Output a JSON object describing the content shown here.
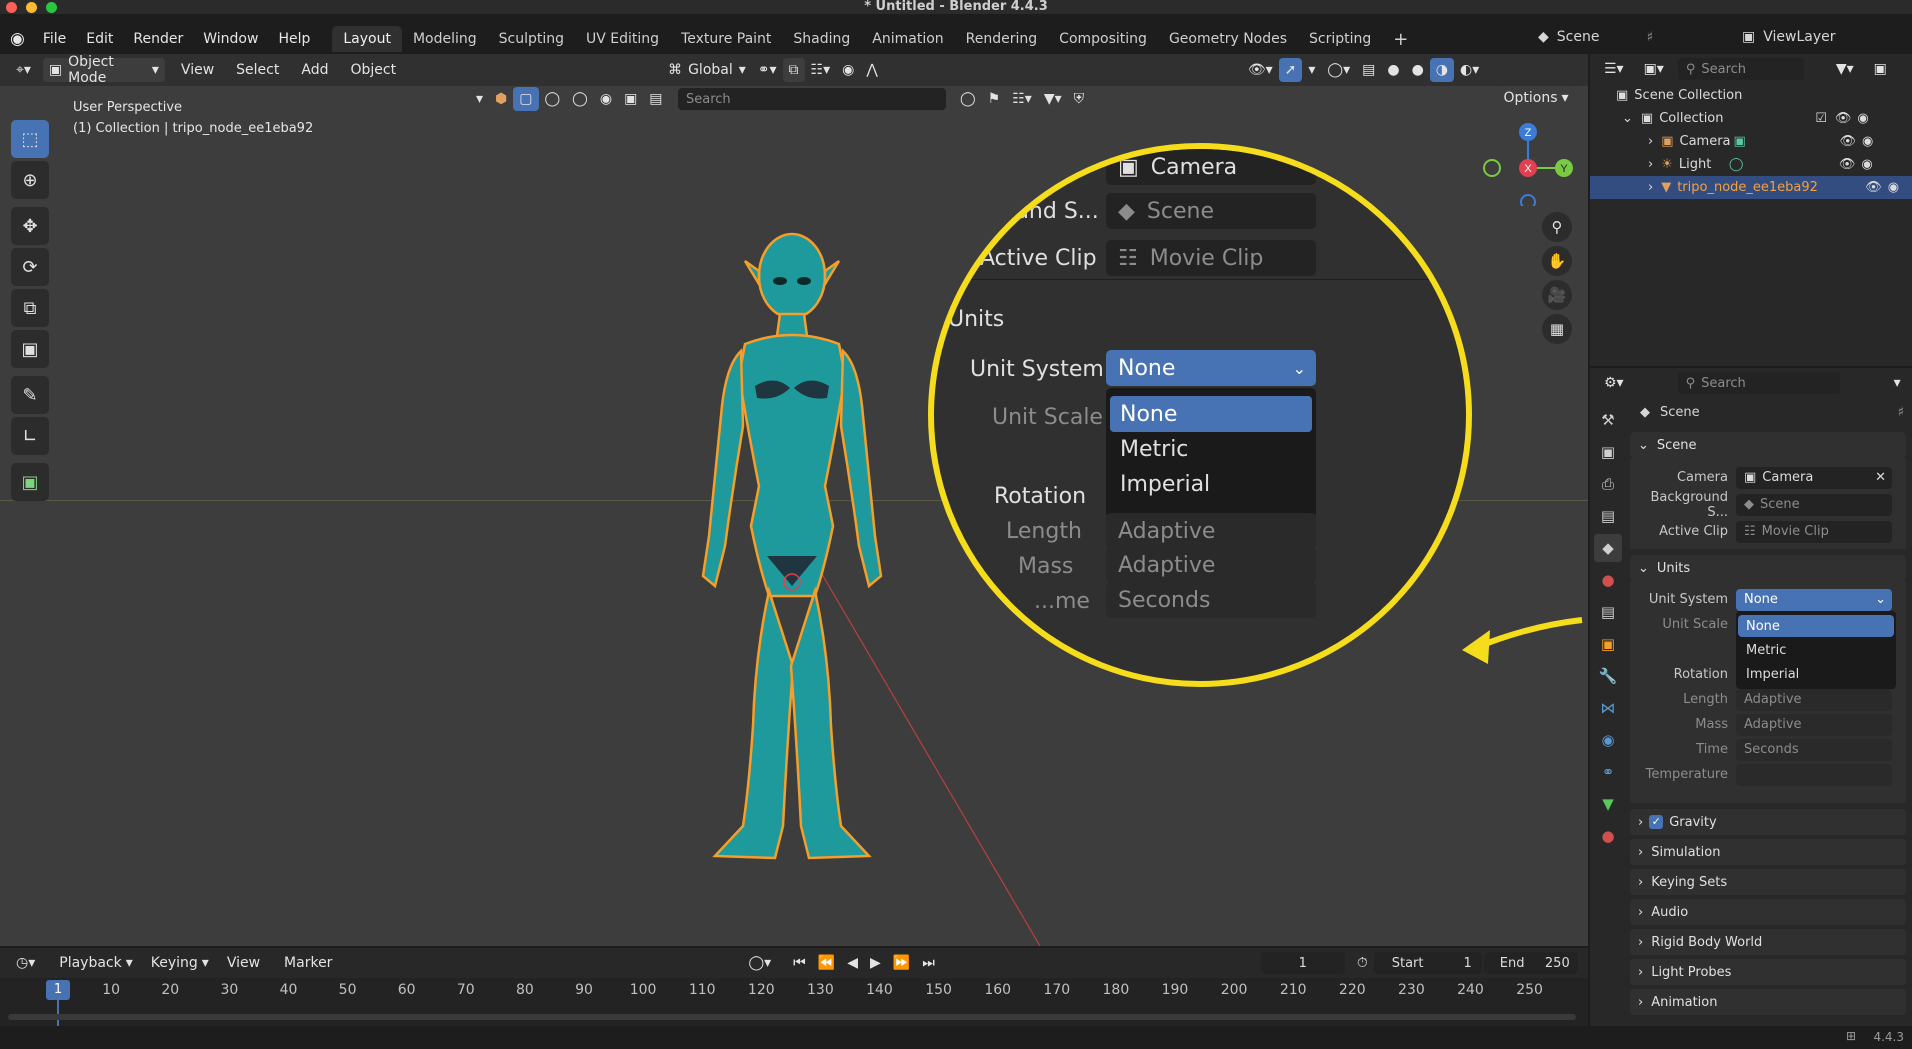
{
  "window": {
    "title": "* Untitled - Blender 4.4.3"
  },
  "menu": {
    "items": [
      "File",
      "Edit",
      "Render",
      "Window",
      "Help"
    ]
  },
  "workspaces": [
    "Layout",
    "Modeling",
    "Sculpting",
    "UV Editing",
    "Texture Paint",
    "Shading",
    "Animation",
    "Rendering",
    "Compositing",
    "Geometry Nodes",
    "Scripting"
  ],
  "top_right": {
    "scene": "Scene",
    "view_layer": "ViewLayer"
  },
  "view_header": {
    "mode": "Object Mode",
    "menus": [
      "View",
      "Select",
      "Add",
      "Object"
    ],
    "transform": "Global",
    "options": "Options",
    "search_placeholder": "Search"
  },
  "viewport": {
    "perspective": "User Perspective",
    "collection_info": "(1) Collection | tripo_node_ee1eba92",
    "gizmo": {
      "z": "Z",
      "x": "X",
      "y": "Y"
    }
  },
  "zoom": {
    "camera_value": "Camera",
    "background_label": "...und S...",
    "background_value": "Scene",
    "clip_label": "Active Clip",
    "clip_value": "Movie Clip",
    "units_header": "Units",
    "unit_system_label": "Unit System",
    "unit_system_value": "None",
    "unit_scale_label": "Unit Scale",
    "rotation_label": "Rotation",
    "length_label": "Length",
    "length_value": "Adaptive",
    "mass_label": "Mass",
    "mass_value": "Adaptive",
    "time_label": "...me",
    "time_value": "Seconds",
    "options": [
      "None",
      "Metric",
      "Imperial"
    ]
  },
  "outliner": {
    "search_placeholder": "Search",
    "root": "Scene Collection",
    "collection": "Collection",
    "items": [
      "Camera",
      "Light",
      "tripo_node_ee1eba92"
    ]
  },
  "properties": {
    "search_placeholder": "Search",
    "context": "Scene",
    "scene_header": "Scene",
    "camera_label": "Camera",
    "camera_value": "Camera",
    "bg_label": "Background S...",
    "bg_value": "Scene",
    "clip_label": "Active Clip",
    "clip_value": "Movie Clip",
    "units_header": "Units",
    "unit_system_label": "Unit System",
    "unit_system_value": "None",
    "unit_scale_label": "Unit Scale",
    "rotation_label": "Rotation",
    "length_label": "Length",
    "length_value": "Adaptive",
    "mass_label": "Mass",
    "mass_value": "Adaptive",
    "time_label": "Time",
    "time_value": "Seconds",
    "temperature_label": "Temperature",
    "dropdown_options": [
      "None",
      "Metric",
      "Imperial"
    ],
    "panels": [
      "Gravity",
      "Simulation",
      "Keying Sets",
      "Audio",
      "Rigid Body World",
      "Light Probes",
      "Animation"
    ]
  },
  "timeline": {
    "menus": [
      "Playback",
      "Keying",
      "View",
      "Marker"
    ],
    "current_frame": "1",
    "start_label": "Start",
    "start_value": "1",
    "end_label": "End",
    "end_value": "250",
    "ticks": [
      "1",
      "10",
      "20",
      "30",
      "40",
      "50",
      "60",
      "70",
      "80",
      "90",
      "100",
      "110",
      "120",
      "130",
      "140",
      "150",
      "160",
      "170",
      "180",
      "190",
      "200",
      "210",
      "220",
      "230",
      "240",
      "250"
    ]
  },
  "status": {
    "version": "4.4.3"
  },
  "colors": {
    "accent": "#4772b3",
    "highlight": "#f5dd1c",
    "selection_outline": "#f59f2a"
  }
}
